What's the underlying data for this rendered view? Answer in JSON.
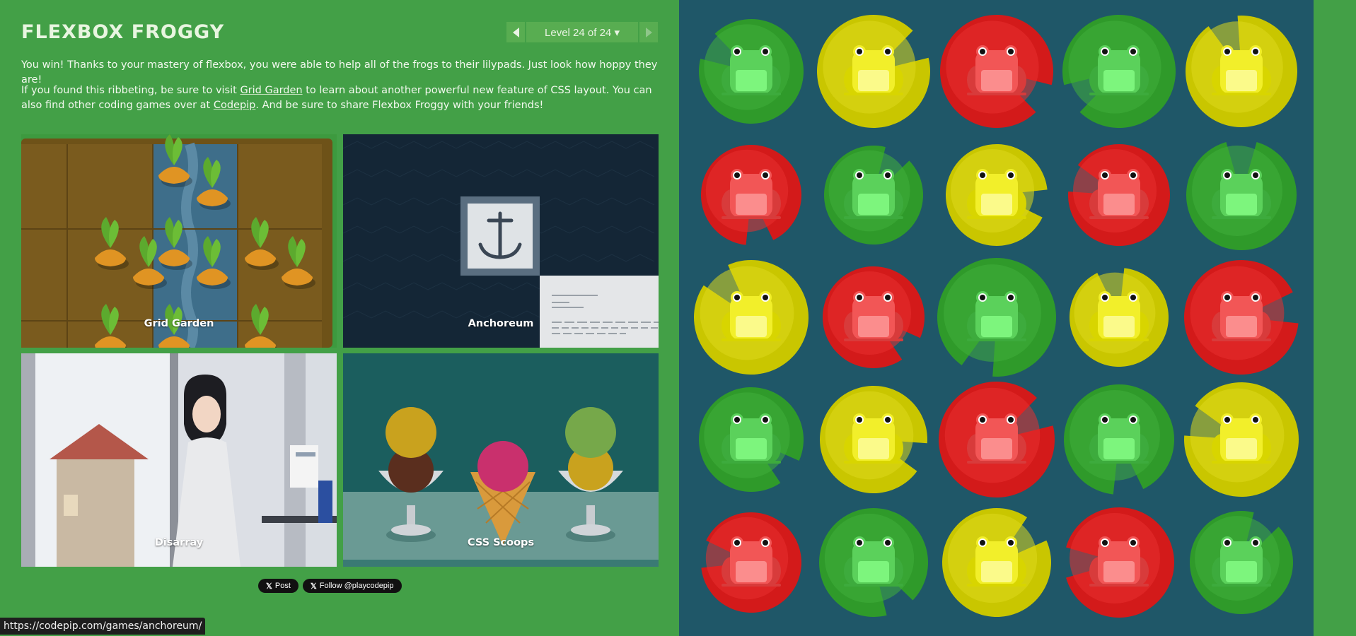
{
  "header": {
    "title": "FLEXBOX FROGGY",
    "level_indicator": "Level 24 of 24 ▾"
  },
  "message": {
    "win_text": "You win! Thanks to your mastery of flexbox, you were able to help all of the frogs to their lilypads. Just look how hoppy they are!",
    "p2_before_link1": "If you found this ribbeting, be sure to visit ",
    "link1": "Grid Garden",
    "p2_between_links": " to learn about another powerful new feature of CSS layout. You can also find other coding games over at ",
    "link2": "Codepip",
    "p2_after_link2": ". And be sure to share Flexbox Froggy with your friends!"
  },
  "games": [
    {
      "label": "Grid Garden"
    },
    {
      "label": "Anchoreum"
    },
    {
      "label": "Disarray"
    },
    {
      "label": "CSS Scoops"
    }
  ],
  "social": {
    "post_label": "Post",
    "follow_label": "Follow @playcodepip"
  },
  "status_bar": {
    "url": "https://codepip.com/games/anchoreum/"
  },
  "colors": {
    "green": "#3a9a2e",
    "yellow": "#cccc00",
    "red": "#d91c1c",
    "pond": "#1f5768",
    "page_green": "#43a047"
  },
  "board": {
    "rows": [
      [
        "green",
        "yellow",
        "red",
        "green",
        "yellow"
      ],
      [
        "red",
        "green",
        "yellow",
        "red",
        "green"
      ],
      [
        "yellow",
        "red",
        "green",
        "yellow",
        "red"
      ],
      [
        "green",
        "yellow",
        "red",
        "green",
        "yellow"
      ],
      [
        "red",
        "green",
        "yellow",
        "red",
        "green"
      ]
    ]
  }
}
